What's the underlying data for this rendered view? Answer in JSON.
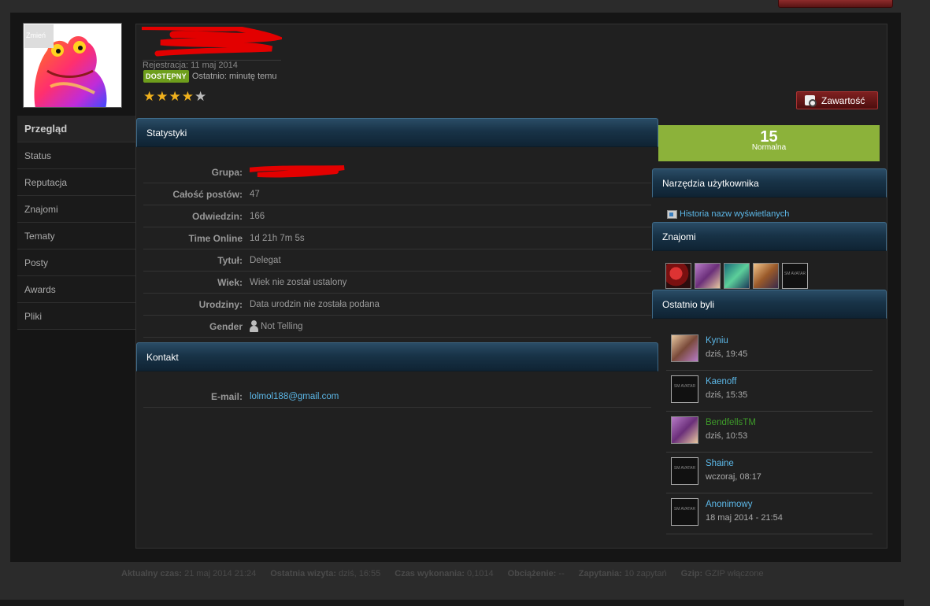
{
  "avatar": {
    "label": "Zmień"
  },
  "profile": {
    "registration": "Rejestracja: 11 maj 2014",
    "online_badge": "DOSTĘPNY",
    "last_active": "Ostatnio: minutę temu",
    "rating": 4,
    "rating_max": 5
  },
  "content_button": "Zawartość",
  "sidebar": {
    "items": [
      {
        "label": "Przegląd"
      },
      {
        "label": "Status"
      },
      {
        "label": "Reputacja"
      },
      {
        "label": "Znajomi"
      },
      {
        "label": "Tematy"
      },
      {
        "label": "Posty"
      },
      {
        "label": "Awards"
      },
      {
        "label": "Pliki"
      }
    ]
  },
  "stats": {
    "header": "Statystyki",
    "rows": [
      {
        "label": "Grupa:",
        "value": ""
      },
      {
        "label": "Całość postów:",
        "value": "47"
      },
      {
        "label": "Odwiedzin:",
        "value": "166"
      },
      {
        "label": "Time Online",
        "value": "1d 21h 7m 5s"
      },
      {
        "label": "Tytuł:",
        "value": "Delegat"
      },
      {
        "label": "Wiek:",
        "value": "Wiek nie został ustalony"
      },
      {
        "label": "Urodziny:",
        "value": "Data urodzin nie została podana"
      },
      {
        "label": "Gender",
        "value": "Not Telling"
      }
    ]
  },
  "contact": {
    "header": "Kontakt",
    "email_label": "E-mail:",
    "email": "lolmol188@gmail.com"
  },
  "reputation": {
    "value": "15",
    "label": "Normalna"
  },
  "tools": {
    "header": "Narzędzia użytkownika",
    "link": "Historia nazw wyświetlanych"
  },
  "friends": {
    "header": "Znajomi",
    "no_avatar_text": "SM AVATAR"
  },
  "visitors": {
    "header": "Ostatnio byli",
    "items": [
      {
        "name": "Kyniu",
        "time": "dziś, 19:45"
      },
      {
        "name": "Kaenoff",
        "time": "dziś, 15:35"
      },
      {
        "name": "BendfellsTM",
        "time": "dziś, 10:53"
      },
      {
        "name": "Shaine",
        "time": "wczoraj, 08:17"
      },
      {
        "name": "Anonimowy",
        "time": "18 maj 2014 - 21:54"
      }
    ]
  },
  "footer": {
    "current_time_label": "Aktualny czas:",
    "current_time": "21 maj 2014 21:24",
    "last_visit_label": "Ostatnia wizyta:",
    "last_visit": "dziś, 16:55",
    "exec_label": "Czas wykonania:",
    "exec": "0,1014",
    "load_label": "Obciążenie:",
    "load": "--",
    "queries_label": "Zapytania:",
    "queries": "10 zapytań",
    "gzip_label": "Gzip:",
    "gzip": "GZIP włączone"
  },
  "colors": {
    "accent_link": "#5cb8e8",
    "online_badge": "#6e9e1c",
    "reputation_bg": "#8cb23a",
    "header_blue": "#183347",
    "button_red": "#7f2020",
    "redaction": "#e30000"
  }
}
